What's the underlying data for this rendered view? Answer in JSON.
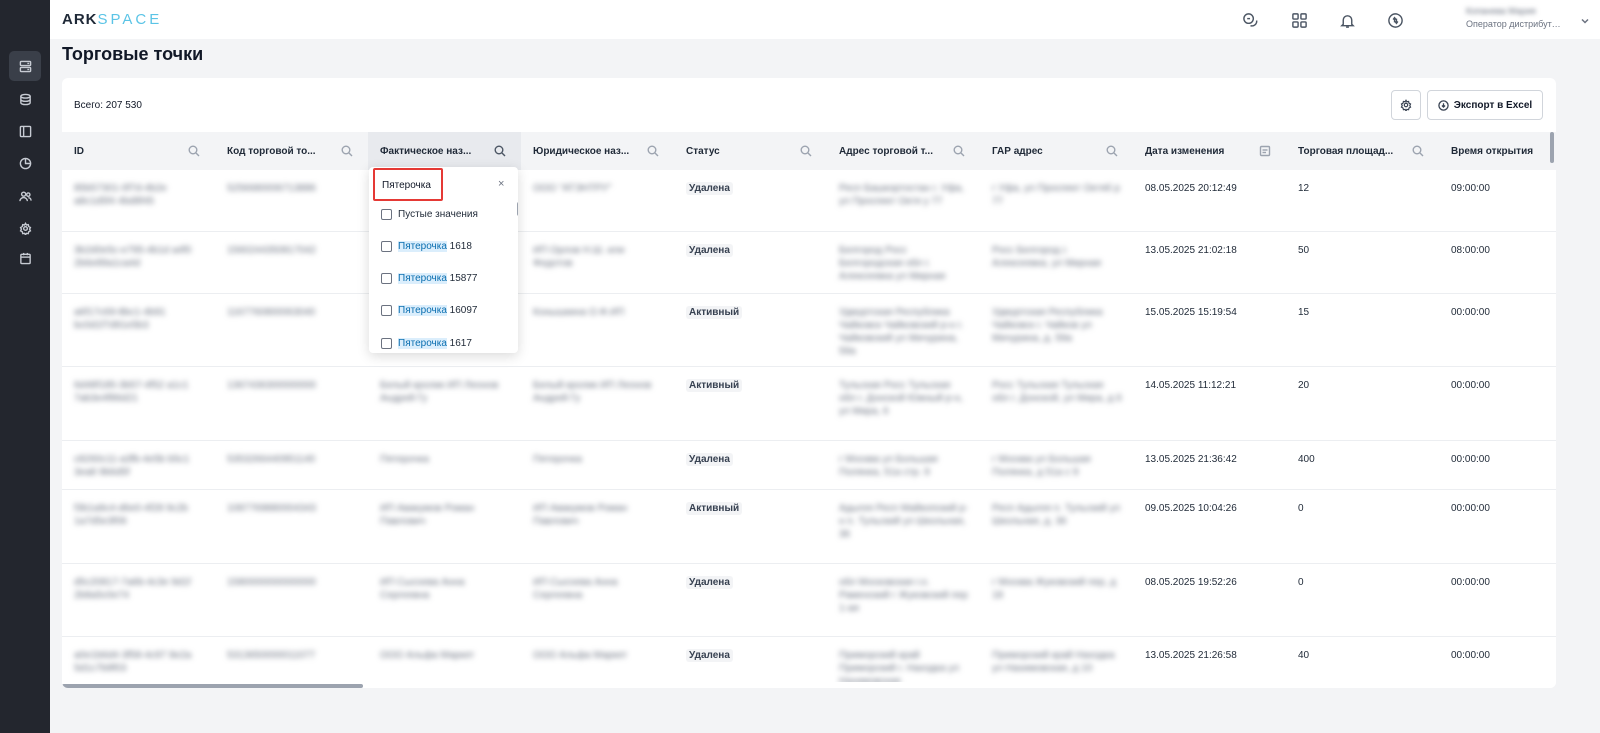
{
  "app": {
    "logo_left": "ARK",
    "logo_right": "SPACE",
    "user_name": "Копанева Мария",
    "user_role": "Оператор дистрибутора"
  },
  "page": {
    "title": "Торговые точки",
    "total": "Всего: 207 530",
    "export_label": "Экспорт в Excel"
  },
  "sidebar": {
    "items": [
      "list-icon",
      "database-icon",
      "panel-icon",
      "pie-chart-icon",
      "users-icon",
      "settings-icon",
      "calendar-icon"
    ]
  },
  "topbar": {
    "icons": [
      "chat-icon",
      "apps-grid-icon",
      "bell-icon",
      "sync-icon",
      "chevron-down-icon"
    ]
  },
  "columns": [
    "ID",
    "Код торговой то...",
    "Фактическое наз...",
    "Юридическое наз...",
    "Статус",
    "Адрес торговой т...",
    "ГАР адрес",
    "Дата изменения",
    "Торговая площад...",
    "Время открытия"
  ],
  "rows": [
    {
      "id": "85b57301-0f7d-4b2e a8c1d5f4 4bd8f45",
      "code": "5256680006713886",
      "fact": "",
      "legal": "ООО \"АТЭНТРУ\"",
      "status": "Удалена",
      "address": "Респ Башкортостан г. Уфа, ул Проспект Октя у 77",
      "gar": "г Уфа, ул Проспект Октяб р 77",
      "date": "08.05.2025 20:12:49",
      "area": "12",
      "open": "09:00:00"
    },
    {
      "id": "3b2d0e5c-e795-4b1d a4f0 2b6e89a1ca4d",
      "code": "1560244350817042",
      "fact": "",
      "legal": "ИП Орлов Н.Ш. или Федотов",
      "status": "Удалена",
      "address": "Белгород Росс Белгородская обл г. Алексеевка ул Мирная",
      "gar": "Росс Белгород г. Алексеевка, ул Мирная",
      "date": "13.05.2025 21:02:18",
      "area": "50",
      "open": "08:00:00"
    },
    {
      "id": "a6f17c69-8bc1-4b91 bc0d1f7d91e5b3",
      "code": "1167760800063040",
      "fact": "",
      "legal": "Конышкина О.Ф.ИП",
      "status": "Активный",
      "address": "Удмуртская Республика Чайковск Чайковский р-н г. Чайковский ул Мичурина, 59а",
      "gar": "Удмуртская Республика Чайковск г. Чайков ул Мичурина, д. 59а",
      "date": "15.05.2025 15:19:54",
      "area": "15",
      "open": "00:00:00"
    },
    {
      "id": "6d48f185-3b57-4f52 a1c1 7ab3e4f86d21",
      "code": "1367436300000000",
      "fact": "Белый кролик ИП Леонов Андрей Гу",
      "legal": "Белый кролик ИП Леонов Андрей Гу",
      "status": "Активный",
      "address": "Тульская Росс Тульская обл г. Донской Южный р-н, ул Мира, 6",
      "gar": "Росс Тульская Тульская обл г. Донской, ул Мира, д 6",
      "date": "14.05.2025 11:12:21",
      "area": "20",
      "open": "00:00:00"
    },
    {
      "id": "c8260c11-a3fb-4e5b b5c1 3ea8 9b6d5f",
      "code": "5353266440951140",
      "fact": "Пятерочка",
      "legal": "Пятерочка",
      "status": "Удалена",
      "address": "г Москва ул Большая Полянка, 51а стр. 9",
      "gar": "г Москва ул Большая Полянка, д 51а с 9",
      "date": "13.05.2025 21:36:42",
      "area": "400",
      "open": "00:00:00"
    },
    {
      "id": "f3b1a9c4-d6e0-4f28 9c2b 1a7d5e3f06",
      "code": "1087769880004343",
      "fact": "ИП Авакумов Роман Павлович",
      "legal": "ИП Авакумов Роман Павлович",
      "status": "Активный",
      "address": "Адыгея Респ Майкопский р-н п. Тульский ул Школьная, 36",
      "gar": "Респ Адыгея п. Тульский ул Школьная, д. 36",
      "date": "09.05.2025 10:04:26",
      "area": "0",
      "open": "00:00:00"
    },
    {
      "id": "d5c20817-7a6b-4c3e 9d1f 2b8a5c0e74",
      "code": "1580000000000000",
      "fact": "ИП Сысоева Анна Сергеевна",
      "legal": "ИП Сысоева Анна Сергеевна",
      "status": "Удалена",
      "address": "обл Московская г.о. Раменский г Жуковский пер 1-ая",
      "gar": "г Москва Жуковский пер, д 18",
      "date": "08.05.2025 19:52:26",
      "area": "0",
      "open": "00:00:00"
    },
    {
      "id": "a0e1b6d4-3f58-4c97 8e2a 5d1c7b9f03",
      "code": "5313650000011077",
      "fact": "ООО Альфа Маркет",
      "legal": "ООО Альфа Маркет",
      "status": "Удалена",
      "address": "Приморский край Приморский г. Находка ул Нахимовская",
      "gar": "Приморский край Находка ул Нахимовская, д 10",
      "date": "13.05.2025 21:26:58",
      "area": "40",
      "open": "00:00:00"
    }
  ],
  "filter_dropdown": {
    "search_value": "Пятерочка",
    "close_glyph": "×",
    "empty_option": "Пустые значения",
    "options": [
      {
        "match": "Пятерочка",
        "rest": " 1618"
      },
      {
        "match": "Пятерочка",
        "rest": " 15877"
      },
      {
        "match": "Пятерочка",
        "rest": " 16097"
      },
      {
        "match": "Пятерочка",
        "rest": " 1617"
      }
    ]
  }
}
